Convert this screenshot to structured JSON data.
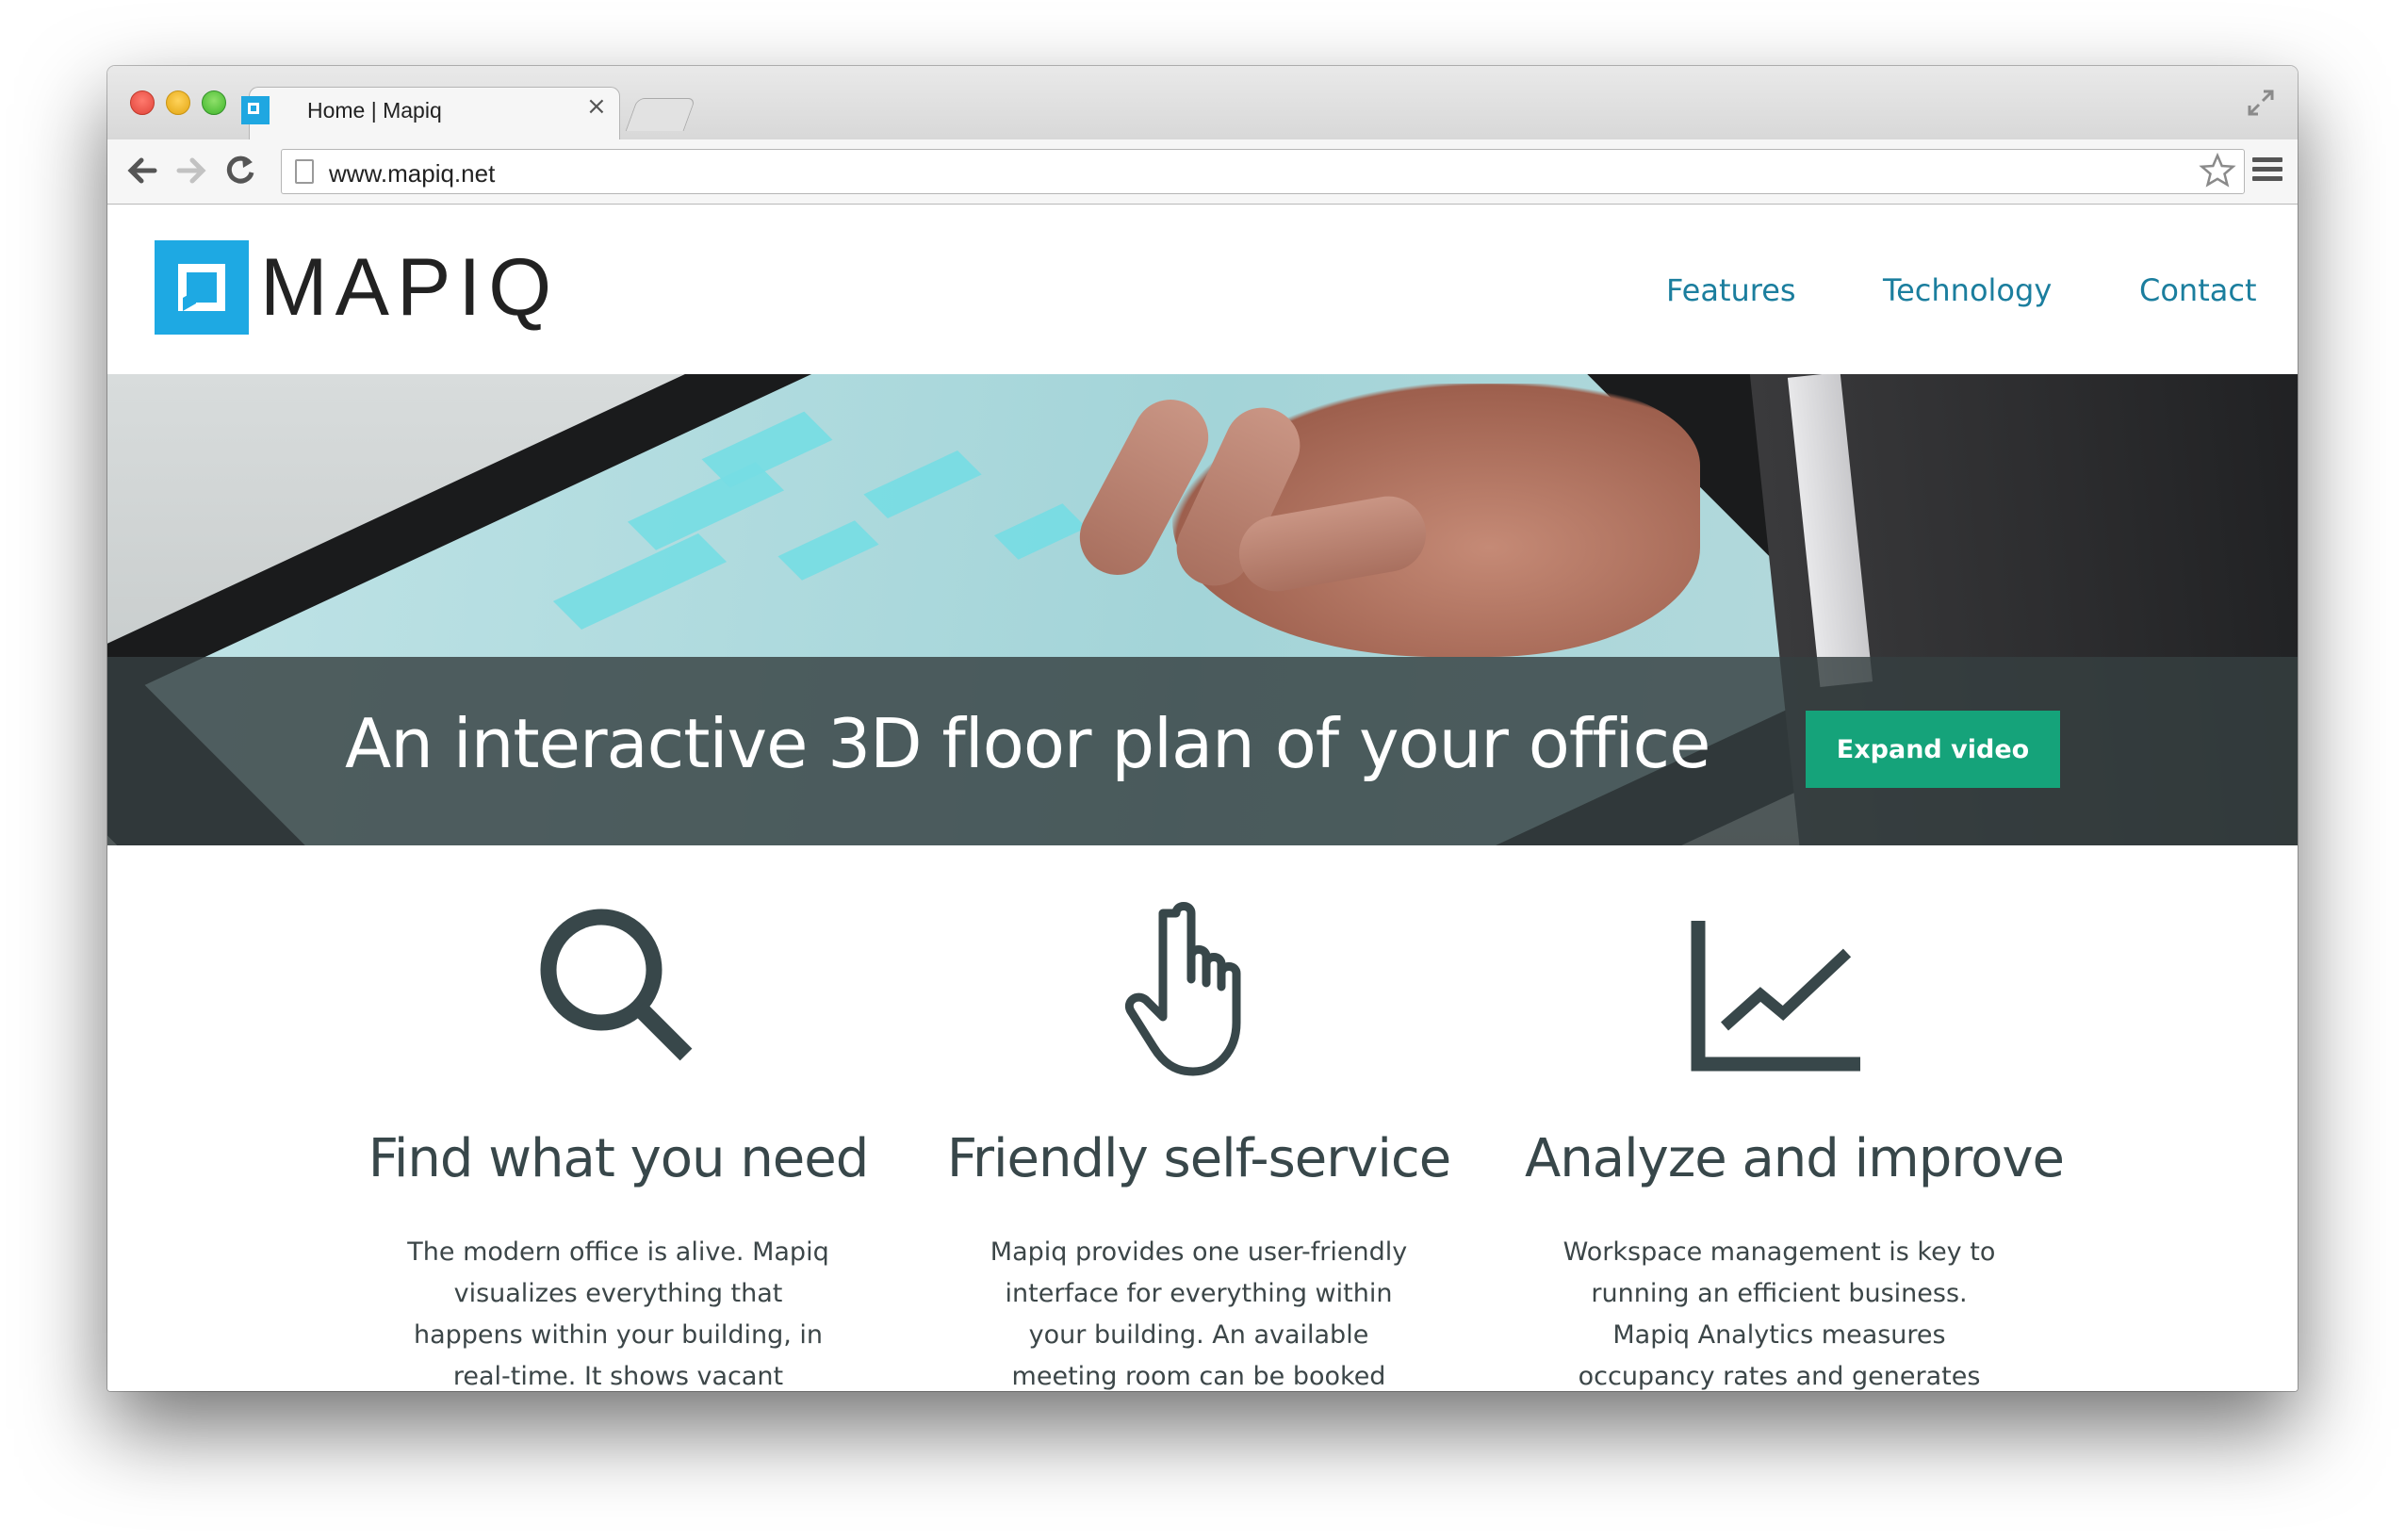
{
  "browser": {
    "tab_title": "Home | Mapiq",
    "tab_close": "×",
    "url": "www.mapiq.net",
    "back_icon": "arrow-left-icon",
    "forward_icon": "arrow-right-icon",
    "reload_icon": "reload-icon",
    "star_icon": "star-icon",
    "menu_icon": "hamburger-menu-icon"
  },
  "site": {
    "logo_text": "MAPIQ",
    "nav": [
      "Features",
      "Technology",
      "Contact"
    ],
    "accent_color": "#1ea9e3",
    "link_color": "#1b7e9e"
  },
  "hero": {
    "title": "An interactive 3D floor plan of your office",
    "button_label": "Expand video",
    "button_color": "#15a37a"
  },
  "features": [
    {
      "icon": "magnifier-icon",
      "title": "Find what you need",
      "body": "The modern office is alive. Mapiq visualizes everything that happens within your building, in real-time. It shows vacant workplaces, available"
    },
    {
      "icon": "pointing-hand-icon",
      "title": "Friendly self-service",
      "body": "Mapiq provides one user-friendly interface for everything within your building. An available meeting room can be booked right away and catering"
    },
    {
      "icon": "line-chart-icon",
      "title": "Analyze and improve",
      "body": "Workspace management is key to running an efficient business. Mapiq Analytics measures occupancy rates and generates reports with interactive"
    }
  ]
}
